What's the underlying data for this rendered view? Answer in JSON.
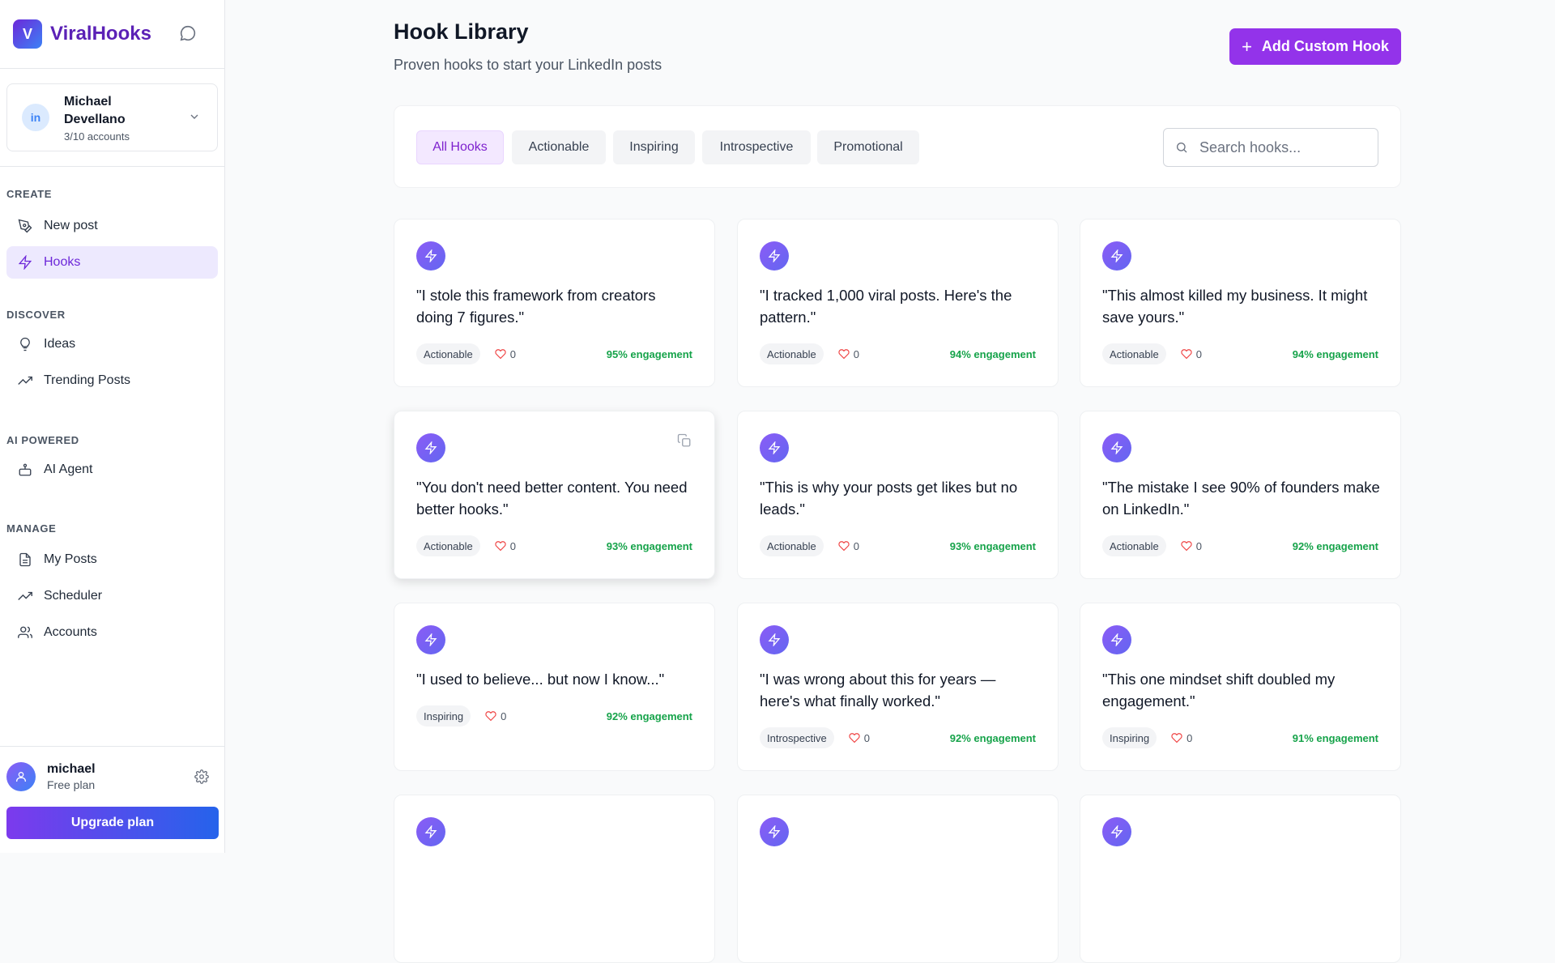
{
  "app": {
    "logo_letter": "V",
    "name": "ViralHooks"
  },
  "account": {
    "avatar": "in",
    "name": "Michael Devellano",
    "count": "3/10 accounts"
  },
  "nav": {
    "create": {
      "heading": "CREATE",
      "new_post": "New post",
      "hooks": "Hooks"
    },
    "discover": {
      "heading": "DISCOVER",
      "ideas": "Ideas",
      "trending": "Trending Posts"
    },
    "ai": {
      "heading": "AI POWERED",
      "agent": "AI Agent"
    },
    "manage": {
      "heading": "MANAGE",
      "my_posts": "My Posts",
      "scheduler": "Scheduler",
      "accounts": "Accounts"
    }
  },
  "user": {
    "name": "michael",
    "plan": "Free plan",
    "upgrade": "Upgrade plan"
  },
  "header": {
    "title": "Hook Library",
    "subtitle": "Proven hooks to start your LinkedIn posts",
    "add_button": "Add Custom Hook",
    "add_icon": "+"
  },
  "filters": {
    "all": "All Hooks",
    "actionable": "Actionable",
    "inspiring": "Inspiring",
    "introspective": "Introspective",
    "promotional": "Promotional"
  },
  "search": {
    "placeholder": "Search hooks..."
  },
  "hooks": [
    {
      "text": "\"I stole this framework from creators doing 7 figures.\"",
      "tag": "Actionable",
      "likes": "0",
      "engagement": "95% engagement"
    },
    {
      "text": "\"I tracked 1,000 viral posts. Here's the pattern.\"",
      "tag": "Actionable",
      "likes": "0",
      "engagement": "94% engagement"
    },
    {
      "text": "\"This almost killed my business. It might save yours.\"",
      "tag": "Actionable",
      "likes": "0",
      "engagement": "94% engagement"
    },
    {
      "text": "\"You don't need better content. You need better hooks.\"",
      "tag": "Actionable",
      "likes": "0",
      "engagement": "93% engagement"
    },
    {
      "text": "\"This is why your posts get likes but no leads.\"",
      "tag": "Actionable",
      "likes": "0",
      "engagement": "93% engagement"
    },
    {
      "text": "\"The mistake I see 90% of founders make on LinkedIn.\"",
      "tag": "Actionable",
      "likes": "0",
      "engagement": "92% engagement"
    },
    {
      "text": "\"I used to believe... but now I know...\"",
      "tag": "Inspiring",
      "likes": "0",
      "engagement": "92% engagement"
    },
    {
      "text": "\"I was wrong about this for years — here's what finally worked.\"",
      "tag": "Introspective",
      "likes": "0",
      "engagement": "92% engagement"
    },
    {
      "text": "\"This one mindset shift doubled my engagement.\"",
      "tag": "Inspiring",
      "likes": "0",
      "engagement": "91% engagement"
    }
  ],
  "colors": {
    "brand": "#6d28d9",
    "accent": "#9333ea",
    "engagement": "#16a34a",
    "heart": "#ef4444"
  }
}
